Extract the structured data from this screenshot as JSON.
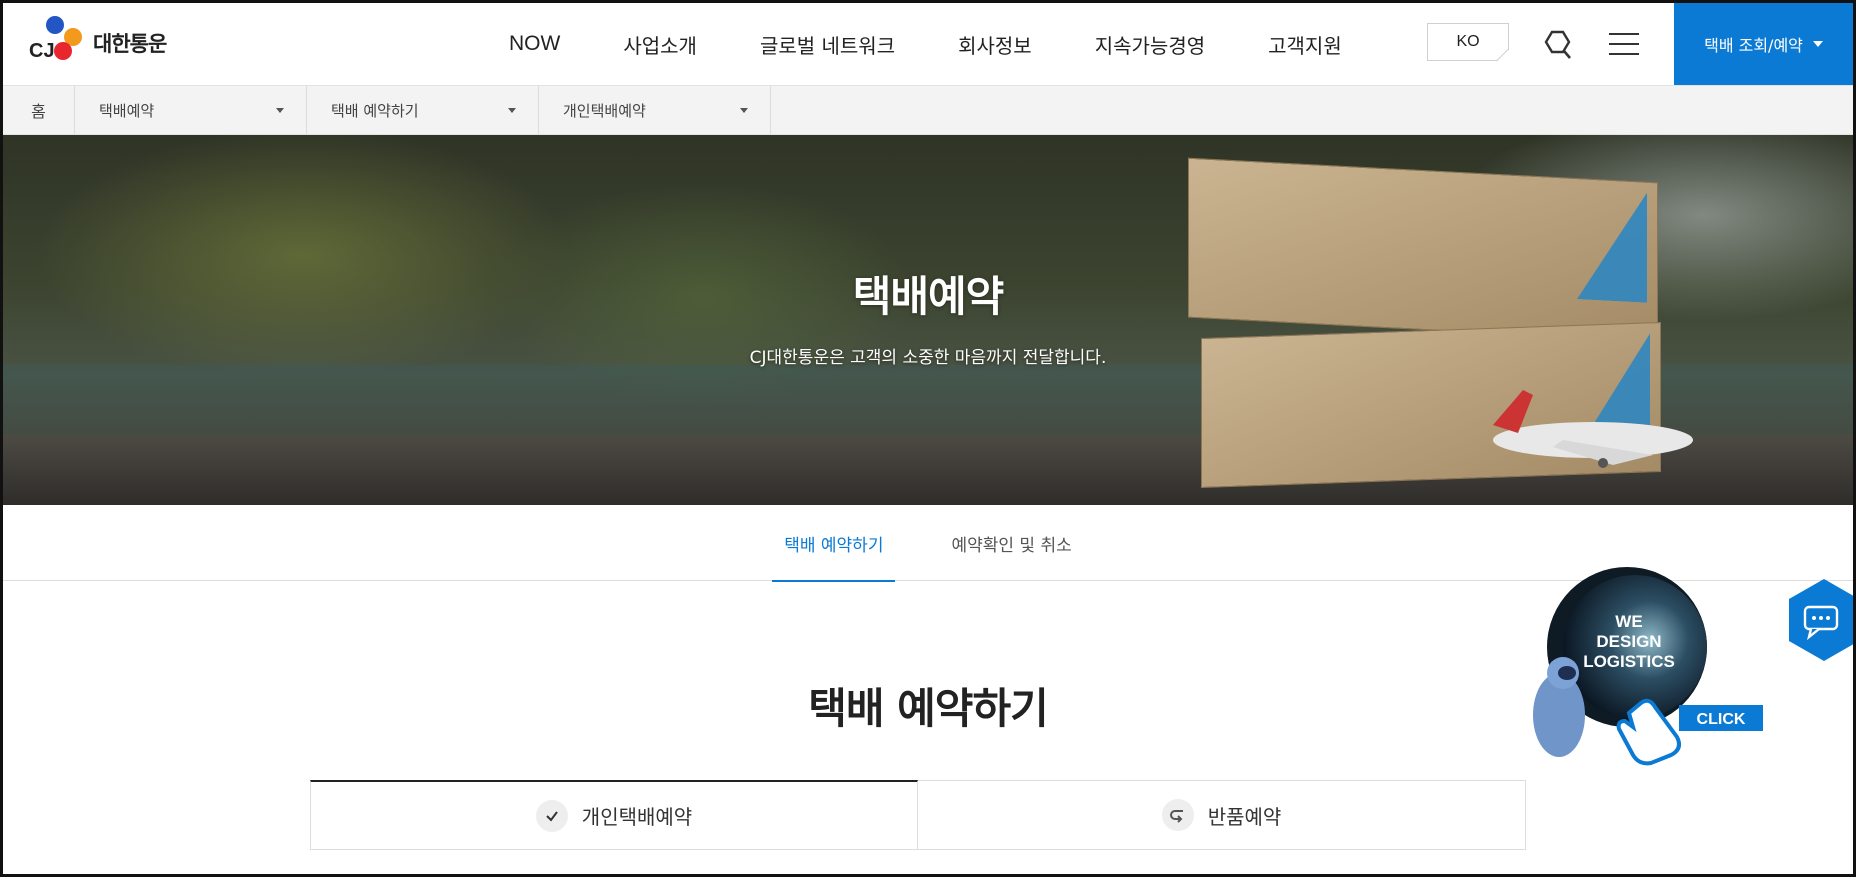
{
  "brand": {
    "logo_mark": "CJ",
    "logo_text": "대한통운"
  },
  "nav": {
    "items": [
      "NOW",
      "사업소개",
      "글로벌 네트워크",
      "회사정보",
      "지속가능경영",
      "고객지원"
    ]
  },
  "header": {
    "language": "KO",
    "track_button": "택배 조회/예약"
  },
  "breadcrumb": {
    "home": "홈",
    "items": [
      "택배예약",
      "택배 예약하기",
      "개인택배예약"
    ]
  },
  "hero": {
    "title": "택배예약",
    "subtitle": "CJ대한통운은 고객의 소중한 마음까지 전달합니다."
  },
  "tabs": [
    {
      "label": "택배 예약하기",
      "active": true
    },
    {
      "label": "예약확인 및 취소",
      "active": false
    }
  ],
  "section": {
    "title": "택배 예약하기"
  },
  "booking_types": [
    {
      "label": "개인택배예약",
      "icon": "check-icon",
      "active": true
    },
    {
      "label": "반품예약",
      "icon": "return-icon",
      "active": false
    }
  ],
  "promo": {
    "line1": "WE",
    "line2": "DESIGN",
    "line3": "LOGISTICS",
    "click": "CLICK"
  },
  "colors": {
    "accent": "#0a7ad4"
  }
}
